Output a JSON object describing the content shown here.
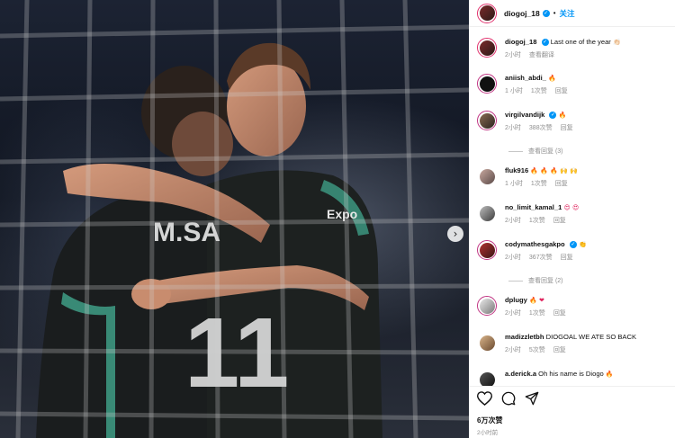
{
  "post": {
    "username": "diogoj_18",
    "follow_label": "关注",
    "likes": "6万次赞",
    "time": "2小时前",
    "icons": [
      "heart-icon",
      "comment-icon",
      "share-icon",
      "next-photo-arrow-icon"
    ],
    "jersey_name": "M.SA",
    "jersey_number": "11",
    "sponsor": "Expo"
  },
  "colors": {
    "accent": "#0095f6",
    "verified": "#0095f6",
    "meta": "#8e8e8e",
    "story_ring": "#e1306c"
  },
  "comments": [
    {
      "user": "diogoj_18",
      "verified": true,
      "text": "Last one of the year",
      "emoji": "👏🏻",
      "time": "2小时",
      "likes": "",
      "action": "查看翻译"
    },
    {
      "user": "aniish_abdi_",
      "verified": false,
      "text": "",
      "emoji": "🔥",
      "time": "1 小时",
      "likes": "1次赞",
      "action": "回复"
    },
    {
      "user": "virgilvandijk",
      "verified": true,
      "text": "",
      "emoji": "🔥",
      "time": "2小时",
      "likes": "388次赞",
      "action": "回复"
    },
    {
      "user": "fluk916",
      "verified": false,
      "text": "",
      "emoji": "🔥 🔥 🔥 🙌 🙌",
      "time": "1 小时",
      "likes": "1次赞",
      "action": "回复"
    },
    {
      "user": "no_limit_kamal_1",
      "verified": false,
      "text": "",
      "emoji": "😍 😍",
      "time": "2小时",
      "likes": "1次赞",
      "action": "回复"
    },
    {
      "user": "codymathesgakpo",
      "verified": true,
      "text": "",
      "emoji": "👏",
      "time": "2小时",
      "likes": "367次赞",
      "action": "回复"
    },
    {
      "user": "dplugy",
      "verified": false,
      "text": "",
      "emoji": "🔥 ❤",
      "time": "2小时",
      "likes": "1次赞",
      "action": "回复"
    },
    {
      "user": "madizzletbh",
      "verified": false,
      "text": "DIOGOAL WE ATE SO BACK",
      "emoji": "",
      "time": "2小时",
      "likes": "5次赞",
      "action": "回复"
    },
    {
      "user": "a.derick.a",
      "verified": false,
      "text": "Oh his name is Diogo",
      "emoji": "🔥",
      "time": "",
      "likes": "",
      "action": ""
    }
  ],
  "replies": [
    {
      "label": "查看回复 (3)"
    },
    {
      "label": "查看回复 (2)"
    }
  ]
}
